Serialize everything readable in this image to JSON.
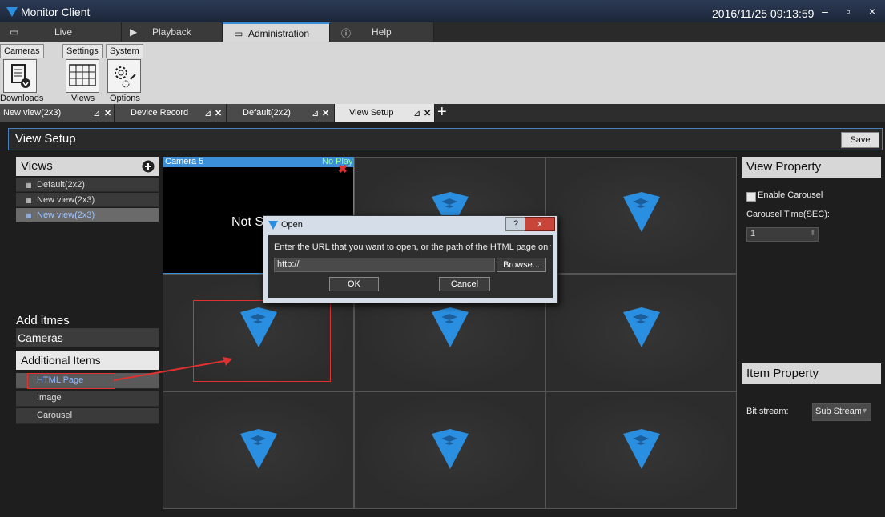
{
  "window": {
    "title": "Monitor Client",
    "clock": "2016/11/25 09:13:59"
  },
  "main_tabs": [
    {
      "label": "Live",
      "icon": "monitor-icon"
    },
    {
      "label": "Playback",
      "icon": "play-icon"
    },
    {
      "label": "Administration",
      "icon": "folder-icon"
    },
    {
      "label": "Help",
      "icon": "question-icon"
    }
  ],
  "ribbon": {
    "groups": [
      "Cameras",
      "Settings",
      "System"
    ],
    "buttons": [
      {
        "label": "Downloads"
      },
      {
        "label": "Views"
      },
      {
        "label": "Options"
      }
    ]
  },
  "doc_tabs": [
    {
      "label": "New view(2x3)"
    },
    {
      "label": "Device Record"
    },
    {
      "label": "Default(2x2)"
    },
    {
      "label": "View Setup"
    }
  ],
  "view_setup": {
    "title": "View Setup",
    "save_label": "Save"
  },
  "views": {
    "header": "Views",
    "items": [
      "Default(2x2)",
      "New view(2x3)",
      "New view(2x3)"
    ]
  },
  "add_items": {
    "header": "Add itmes",
    "sections": [
      "Cameras",
      "Additional Items"
    ],
    "items": [
      "HTML Page",
      "Image",
      "Carousel"
    ]
  },
  "grid": {
    "camera_label": "Camera 5",
    "status_label": "No Play",
    "cell_text": "Not S"
  },
  "view_property": {
    "header": "View Property",
    "carousel_label": "Enable Carousel",
    "carousel_time_label": "Carousel Time(SEC):",
    "carousel_time_value": "1"
  },
  "item_property": {
    "header": "Item Property",
    "bitstream_label": "Bit stream:",
    "bitstream_value": "Sub Stream"
  },
  "dialog": {
    "title": "Open",
    "prompt": "Enter the URL that you want to open, or the path of the HTML page on the",
    "url_value": "http://",
    "browse_label": "Browse...",
    "ok_label": "OK",
    "cancel_label": "Cancel",
    "help_label": "?",
    "close_label": "x"
  },
  "colors": {
    "accent": "#3b8fd9",
    "logo_blue": "#2a8fe0",
    "annotation_red": "#e03030"
  }
}
